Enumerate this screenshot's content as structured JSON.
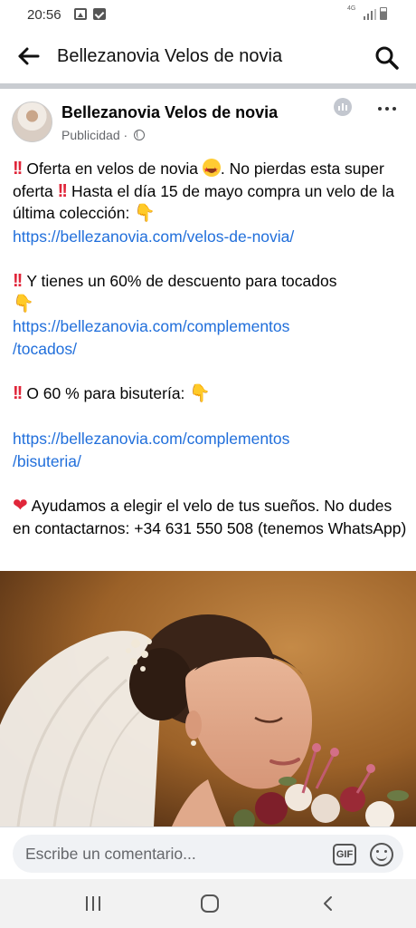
{
  "status_bar": {
    "time": "20:56",
    "network": "4G"
  },
  "header": {
    "title": "Bellezanovia Velos de novia"
  },
  "post": {
    "page_name": "Bellezanovia Velos de novia",
    "sponsored_label": "Publicidad",
    "paragraph1": {
      "text_a": "Oferta en velos de novia",
      "text_b": ". No pierdas esta super oferta",
      "text_c": "Hasta el día 15 de mayo compra un velo de la última colección:",
      "link": "https://bellezanovia.com/velos-de-novia/"
    },
    "paragraph2": {
      "text": "Y tienes un 60% de descuento para tocados",
      "link_line1": "https://bellezanovia.com/complementos",
      "link_line2": "/tocados/"
    },
    "paragraph3": {
      "text": "O 60 % para bisutería:",
      "link_line1": "https://bellezanovia.com/complementos",
      "link_line2": "/bisuteria/"
    },
    "paragraph4": {
      "text": "Ayudamos a elegir el velo de tus sueños. No dudes en contactarnos: +34 631 550 508 (tenemos WhatsApp)"
    }
  },
  "comment_bar": {
    "placeholder": "Escribe un comentario...",
    "gif_label": "GIF"
  },
  "colors": {
    "link": "#216fdb",
    "emoji_red": "#e0263a"
  }
}
